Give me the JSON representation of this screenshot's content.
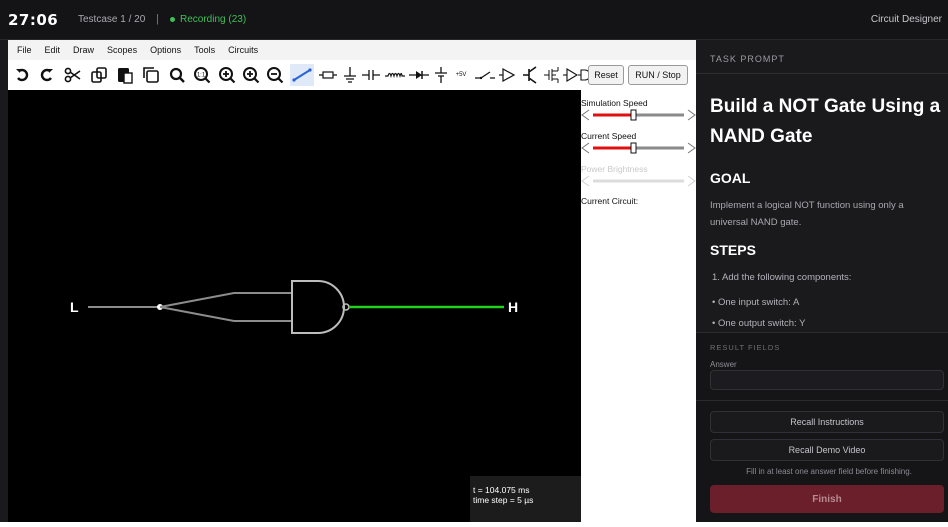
{
  "topbar": {
    "timer": "27:06",
    "testcase": "Testcase 1 / 20",
    "separator": "|",
    "recording": "Recording (23)",
    "app_name": "Circuit Designer",
    "recording_color": "#3fbf57"
  },
  "simulator": {
    "menu": [
      "File",
      "Edit",
      "Draw",
      "Scopes",
      "Options",
      "Tools",
      "Circuits"
    ],
    "toolbar_icons": [
      "undo-icon",
      "redo-icon",
      "cut-icon",
      "copy-icon",
      "paste-icon",
      "duplicate-icon",
      "search-icon",
      "zoom-fit-icon",
      "zoom-in-icon",
      "zoom-out-icon",
      "wire-icon",
      "resistor-icon",
      "ground-icon",
      "capacitor-icon",
      "inductor-icon",
      "diode-icon",
      "battery-icon",
      "voltage-source-icon",
      "switch-icon",
      "buffer-icon",
      "transistor-icon",
      "mosfet-icon",
      "opamp-icon",
      "and-gate-icon"
    ],
    "voltage_label": "+5V",
    "reset_label": "Reset",
    "run_label": "RUN / Stop",
    "side": {
      "sim_speed_label": "Simulation Speed",
      "current_speed_label": "Current Speed",
      "power_brightness_label": "Power Brightness",
      "current_circuit_label": "Current Circuit:"
    },
    "circuit": {
      "input_label": "L",
      "output_label": "H",
      "active_wire_color": "#1ed21e",
      "idle_wire_color": "#8c8c8c"
    },
    "time_info": {
      "time": "t = 104.075 ms",
      "step": "time step = 5 µs"
    }
  },
  "panel": {
    "section_label": "TASK PROMPT",
    "title": "Build a NOT Gate Using a NAND Gate",
    "goal_heading": "GOAL",
    "goal_text": "Implement a logical NOT function using only a universal NAND gate.",
    "steps_heading": "STEPS",
    "step_1": "1. Add the following components:",
    "bullet_1": "• One input switch: A",
    "bullet_2": "• One output switch: Y",
    "result_heading": "RESULT FIELDS",
    "answer_label": "Answer",
    "answer_value": "",
    "recall_instructions": "Recall Instructions",
    "recall_video": "Recall Demo Video",
    "hint": "Fill in at least one answer field before finishing.",
    "finish": "Finish",
    "finish_color": "#6a1f2a"
  }
}
